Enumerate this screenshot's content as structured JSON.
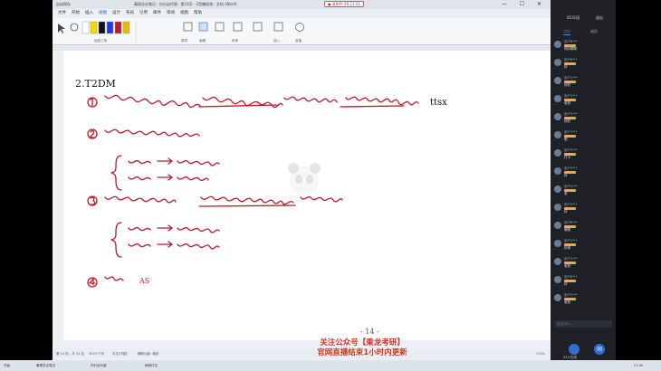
{
  "word": {
    "title_left": "自动保存",
    "title": "毒理总论笔记 · 内分泌代谢 · 第14页 · 2型糖尿病 · 文档 (Word)",
    "recording_label": "● 录制中 00:13:51",
    "window_controls": "— ☐ ✕",
    "menus": [
      "文件",
      "开始",
      "插入",
      "绘图",
      "设计",
      "布局",
      "引用",
      "邮件",
      "审阅",
      "视图",
      "帮助"
    ],
    "active_menu": "绘图",
    "ribbon_labels": [
      "绘图工具",
      "模具",
      "编辑",
      "转换",
      "插入",
      "重播"
    ],
    "status_left": "第 14 页，共 19 页",
    "status_words": "3074 个字",
    "status_lang": "中文(中国)",
    "status_access": "辅助功能: 调查",
    "status_zoom": "170%"
  },
  "page": {
    "heading": "2.T2DM",
    "label_ttsx": "ttsx",
    "page_number": "- 14 -",
    "handwriting": [
      "① 肥胖在接收不到时，首选 饮食运动疗法，否则首选 双胍(GFR<45禁用)",
      "② 空腹血糖已经高 (和7比)",
      "{ 肥胖 → 二甲双胍",
      "  消瘦 → 磺脲类",
      "③ 空腹血糖尚可，但餐后血糖明显增高 (和11.1比)",
      "{ 肥胖 → 阿卡波糖",
      "  消瘦 → 格列奈类",
      "④ 伴 AS"
    ]
  },
  "banner": {
    "line1": "关注公众号【乘龙考研】",
    "line2": "官网直播结束1小时内更新"
  },
  "panel": {
    "top_left": "0531班",
    "top_right": "退出",
    "tabs": [
      "讨论",
      "成员"
    ],
    "chats": [
      {
        "name": "用户6***",
        "msg": "同问眼睛"
      },
      {
        "name": "用户8***",
        "msg": "好"
      },
      {
        "name": "用户2***",
        "msg": "好的"
      },
      {
        "name": "用户1***",
        "msg": "收到"
      },
      {
        "name": "用户5***",
        "msg": "好的"
      },
      {
        "name": "用户7***",
        "msg": "嗯"
      },
      {
        "name": "用户3***",
        "msg": "打卡"
      },
      {
        "name": "用户9***",
        "msg": "好"
      },
      {
        "name": "用户4***",
        "msg": "收"
      },
      {
        "name": "用户0***",
        "msg": "好"
      },
      {
        "name": "用户6***",
        "msg": "嗯嗯"
      },
      {
        "name": "用户2***",
        "msg": "好滴"
      },
      {
        "name": "用户1***",
        "msg": "收到"
      },
      {
        "name": "用户8***",
        "msg": "好"
      },
      {
        "name": "用户5***",
        "msg": "收到"
      }
    ],
    "input_placeholder": "说点什么...",
    "online_count": "33人在线"
  },
  "taskbar": [
    "开始",
    "毒理总论笔记",
    "内分泌代谢",
    "病例讨论",
    "21:40"
  ],
  "colors": {
    "ink": "#c0192a",
    "accent": "#1e5fbf",
    "banner": "#d0311f",
    "badge": "#f3a93a"
  }
}
